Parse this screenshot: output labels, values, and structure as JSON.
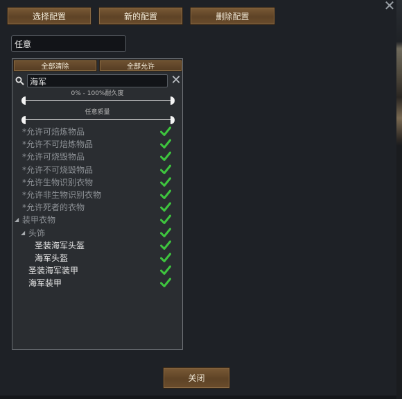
{
  "toolbar": {
    "select_label": "选择配置",
    "new_label": "新的配置",
    "delete_label": "删除配置"
  },
  "name_field": {
    "value": "任意"
  },
  "filter": {
    "clear_all_label": "全部清除",
    "allow_all_label": "全部允许",
    "search_value": "海军",
    "durability_label": "0% - 100%耐久度",
    "quality_label": "任意质量",
    "durability_range": [
      0,
      100
    ]
  },
  "items": [
    {
      "label": "*允许可焙炼物品",
      "checked": true
    },
    {
      "label": "*允许不可焙炼物品",
      "checked": true
    },
    {
      "label": "*允许可烧毁物品",
      "checked": true
    },
    {
      "label": "*允许不可烧毁物品",
      "checked": true
    },
    {
      "label": "*允许生物识别衣物",
      "checked": true
    },
    {
      "label": "*允许非生物识别衣物",
      "checked": true
    },
    {
      "label": "*允许死者的衣物",
      "checked": true
    },
    {
      "label": "装甲衣物",
      "checked": true,
      "expanded": true
    },
    {
      "label": "头饰",
      "checked": true,
      "expanded": true
    },
    {
      "label": "圣装海军头盔",
      "checked": true
    },
    {
      "label": "海军头盔",
      "checked": true
    },
    {
      "label": "圣装海军装甲",
      "checked": true
    },
    {
      "label": "海军装甲",
      "checked": true
    }
  ],
  "footer": {
    "close_label": "关闭"
  },
  "icons": {
    "close": "close-icon",
    "search": "search-icon",
    "clear": "clear-icon",
    "check": "checkmark-icon",
    "expand": "triangle-down-icon"
  },
  "colors": {
    "check": "#3ec53e",
    "button_wood": "#6a4c2c"
  }
}
